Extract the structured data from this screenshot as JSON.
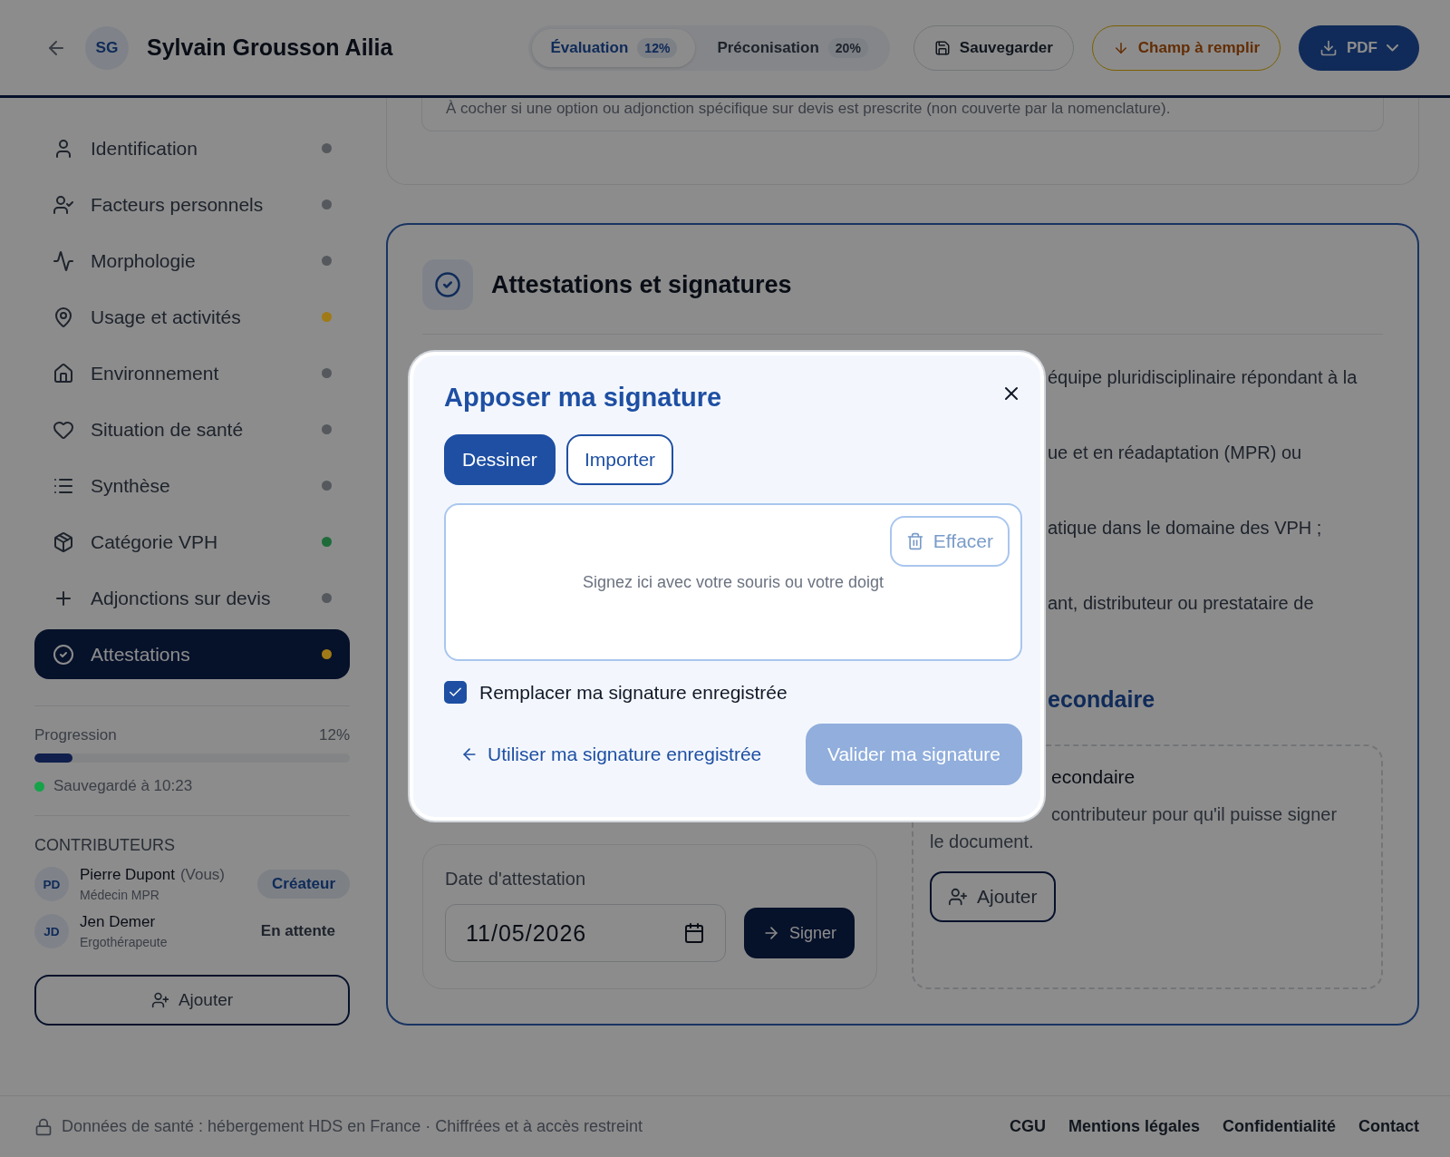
{
  "header": {
    "initials": "SG",
    "name": "Sylvain Grousson Ailia",
    "tabs": [
      {
        "label": "Évaluation",
        "percent": "12%",
        "selected": true
      },
      {
        "label": "Préconisation",
        "percent": "20%",
        "selected": false
      }
    ],
    "save_button": "Sauvegarder",
    "required_button": "Champ à remplir",
    "pdf_button": "PDF"
  },
  "sidebar": {
    "items": [
      {
        "label": "Identification",
        "selected": false,
        "color": "#55585d"
      },
      {
        "label": "Facteurs personnels",
        "selected": false,
        "color": "#55585d"
      },
      {
        "label": "Morphologie",
        "selected": false,
        "color": "#55585d"
      },
      {
        "label": "Usage et activités",
        "selected": false,
        "color": "#a07a16"
      },
      {
        "label": "Environnement",
        "selected": false,
        "color": "#55585d"
      },
      {
        "label": "Situation de santé",
        "selected": false,
        "color": "#55585d"
      },
      {
        "label": "Synthèse",
        "selected": false,
        "color": "#55585d"
      },
      {
        "label": "Catégorie VPH",
        "selected": false,
        "color": "#1e6b3a"
      },
      {
        "label": "Adjonctions sur devis",
        "selected": false,
        "color": "#55585d"
      },
      {
        "label": "Attestations",
        "selected": true,
        "color": "#a07a16"
      }
    ],
    "progress": {
      "label": "Progression",
      "reading": "12%",
      "level": 0.12
    },
    "saved": "Sauvegardé à 10:23",
    "contributors_title": "CONTRIBUTEURS",
    "contributors": [
      {
        "initials": "PD",
        "name": "Pierre Dupont",
        "you": "(Vous)",
        "role": "Médecin MPR",
        "status": "Créateur",
        "kind": "creator"
      },
      {
        "initials": "JD",
        "name": "Jen Demer",
        "role": "Ergothérapeute",
        "status": "En attente",
        "kind": "pending"
      }
    ],
    "add_button": "Ajouter"
  },
  "main": {
    "note": "À cocher si une option ou adjonction spécifique sur devis est prescrite (non couverte par la nomenclature).",
    "section_title": "Attestations et signatures",
    "fragments": [
      "équipe pluridisciplinaire répondant à la",
      "ue et en réadaptation (MPR) ou",
      "atique dans le domaine des VPH ;",
      "ant, distributeur ou prestataire de"
    ],
    "subheading": "econdaire",
    "date_label": "Date d'attestation",
    "date_value": "11/05/2026",
    "sign_button": "Signer",
    "secondary_title": "econdaire",
    "secondary_text": "contributeur pour qu'il puisse signer le document.",
    "secondary_add": "Ajouter"
  },
  "modal": {
    "title": "Apposer ma signature",
    "tabs": [
      {
        "label": "Dessiner",
        "selected": true
      },
      {
        "label": "Importer",
        "selected": false
      }
    ],
    "pad_placeholder": "Signez ici avec votre souris ou votre doigt",
    "clear_button": "Effacer",
    "replace_label": "Remplacer ma signature enregistrée",
    "replace_checked": true,
    "use_saved_link": "Utiliser ma signature enregistrée",
    "validate_button": "Valider ma signature",
    "validate_disabled": true
  },
  "footer": {
    "notice": "Données de santé : hébergement HDS en France · Chiffrées et à accès restreint",
    "links": [
      "CGU",
      "Mentions légales",
      "Confidentialité",
      "Contact"
    ]
  }
}
